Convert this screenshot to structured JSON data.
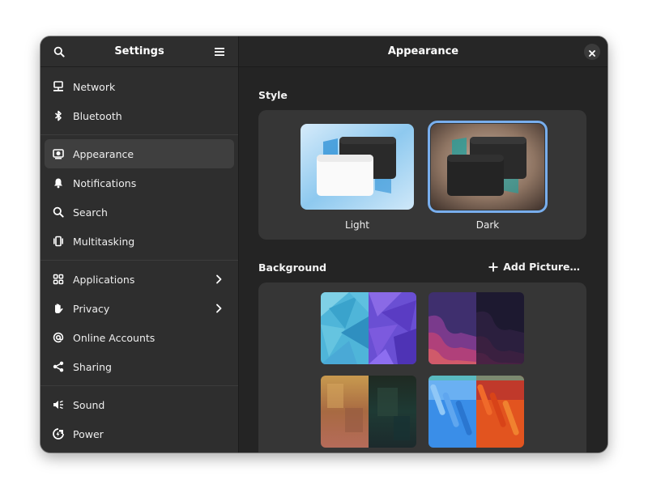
{
  "sidebar": {
    "title": "Settings",
    "search_icon": "search-icon",
    "menu_icon": "hamburger-menu-icon",
    "items": [
      {
        "label": "Network",
        "icon": "network-wired-icon"
      },
      {
        "label": "Bluetooth",
        "icon": "bluetooth-icon"
      },
      {
        "label": "Appearance",
        "icon": "appearance-icon",
        "selected": true
      },
      {
        "label": "Notifications",
        "icon": "bell-icon"
      },
      {
        "label": "Search",
        "icon": "search-icon"
      },
      {
        "label": "Multitasking",
        "icon": "multitasking-icon"
      },
      {
        "label": "Applications",
        "icon": "grid-icon",
        "has_submenu": true
      },
      {
        "label": "Privacy",
        "icon": "hand-icon",
        "has_submenu": true
      },
      {
        "label": "Online Accounts",
        "icon": "at-sign-icon"
      },
      {
        "label": "Sharing",
        "icon": "share-icon"
      },
      {
        "label": "Sound",
        "icon": "speaker-icon"
      },
      {
        "label": "Power",
        "icon": "power-plug-icon"
      }
    ]
  },
  "main": {
    "title": "Appearance",
    "close_icon": "close-icon",
    "style": {
      "label": "Style",
      "options": [
        {
          "label": "Light",
          "selected": false
        },
        {
          "label": "Dark",
          "selected": true
        }
      ]
    },
    "background": {
      "label": "Background",
      "add_label": "Add Picture…"
    }
  },
  "colors": {
    "accent": "#78aeed",
    "window_bg": "#242424",
    "sidebar_bg": "#2e2e2e",
    "card_bg": "#363636"
  }
}
